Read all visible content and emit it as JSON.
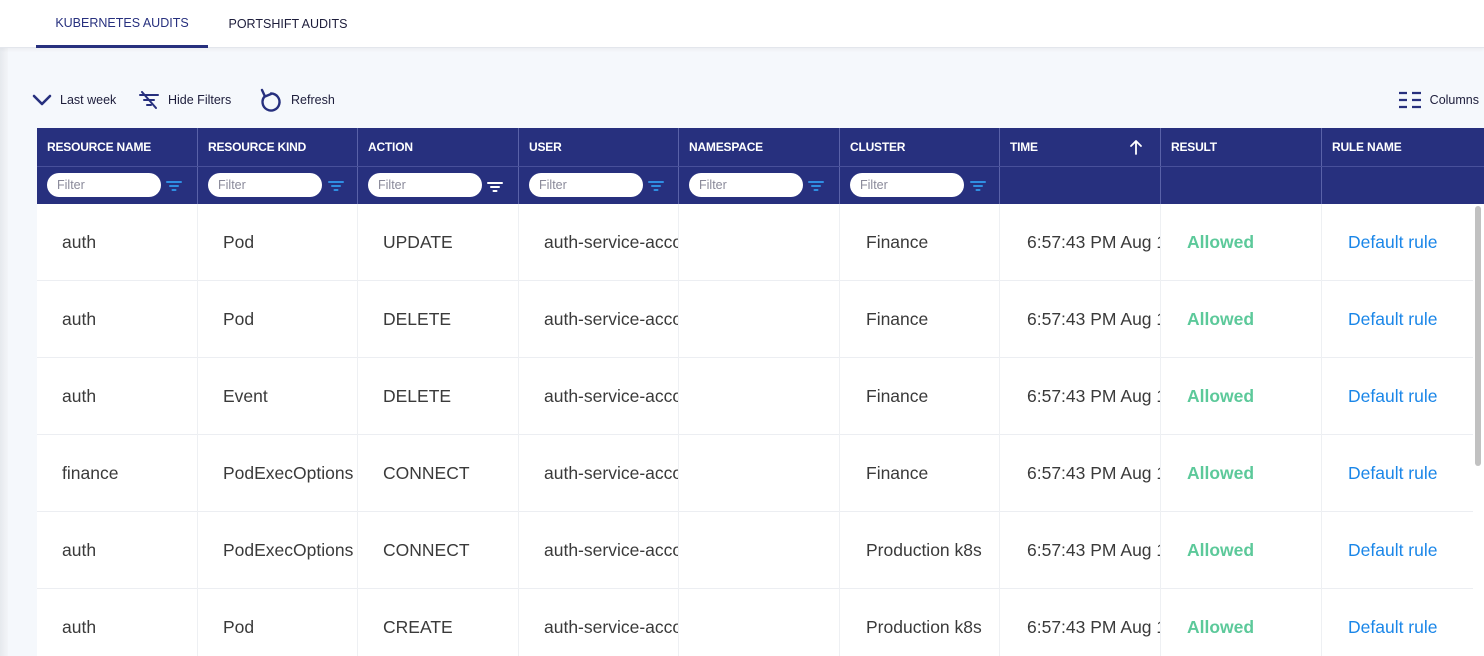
{
  "tabs": [
    {
      "label": "KUBERNETES AUDITS",
      "active": true
    },
    {
      "label": "PORTSHIFT AUDITS",
      "active": false
    }
  ],
  "toolbar": {
    "last_week": "Last week",
    "hide_filters": "Hide Filters",
    "refresh": "Refresh",
    "columns": "Columns"
  },
  "filter_placeholder": "Filter",
  "columns": [
    "RESOURCE NAME",
    "RESOURCE KIND",
    "ACTION",
    "USER",
    "NAMESPACE",
    "CLUSTER",
    "TIME",
    "RESULT",
    "RULE NAME"
  ],
  "rows": [
    {
      "resource_name": "auth",
      "resource_kind": "Pod",
      "action": "UPDATE",
      "user": "auth-service-acco",
      "namespace": "",
      "cluster": "Finance",
      "time": "6:57:43 PM Aug 1",
      "result": "Allowed",
      "rule_name": "Default rule"
    },
    {
      "resource_name": "auth",
      "resource_kind": "Pod",
      "action": "DELETE",
      "user": "auth-service-acco",
      "namespace": "",
      "cluster": "Finance",
      "time": "6:57:43 PM Aug 1",
      "result": "Allowed",
      "rule_name": "Default rule"
    },
    {
      "resource_name": "auth",
      "resource_kind": "Event",
      "action": "DELETE",
      "user": "auth-service-acco",
      "namespace": "",
      "cluster": "Finance",
      "time": "6:57:43 PM Aug 1",
      "result": "Allowed",
      "rule_name": "Default rule"
    },
    {
      "resource_name": "finance",
      "resource_kind": "PodExecOptions",
      "action": "CONNECT",
      "user": "auth-service-acco",
      "namespace": "",
      "cluster": "Finance",
      "time": "6:57:43 PM Aug 1",
      "result": "Allowed",
      "rule_name": "Default rule"
    },
    {
      "resource_name": "auth",
      "resource_kind": "PodExecOptions",
      "action": "CONNECT",
      "user": "auth-service-acco",
      "namespace": "",
      "cluster": "Production k8s",
      "time": "6:57:43 PM Aug 1",
      "result": "Allowed",
      "rule_name": "Default rule"
    },
    {
      "resource_name": "auth",
      "resource_kind": "Pod",
      "action": "CREATE",
      "user": "auth-service-acco",
      "namespace": "",
      "cluster": "Production k8s",
      "time": "6:57:43 PM Aug 1",
      "result": "Allowed",
      "rule_name": "Default rule"
    }
  ],
  "colors": {
    "header_bg": "#27307e",
    "result_allowed": "#5cc99a",
    "link": "#1a86e8",
    "filter_icon": "#2f8fe3"
  }
}
